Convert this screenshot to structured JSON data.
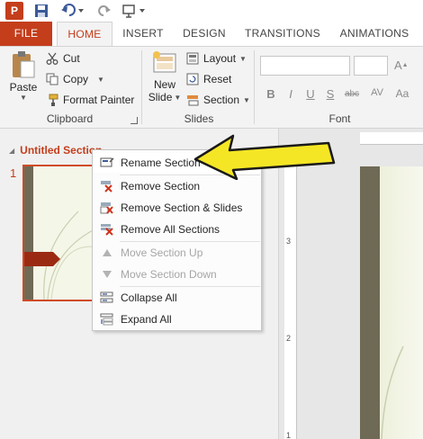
{
  "qat": {
    "app_logo_letter": "P",
    "icons": [
      "powerpoint-logo",
      "save-icon",
      "undo-icon",
      "redo-icon",
      "present-icon"
    ]
  },
  "tabs": [
    {
      "label": "FILE"
    },
    {
      "label": "HOME"
    },
    {
      "label": "INSERT"
    },
    {
      "label": "DESIGN"
    },
    {
      "label": "TRANSITIONS"
    },
    {
      "label": "ANIMATIONS"
    }
  ],
  "ribbon": {
    "clipboard": {
      "paste_label": "Paste",
      "cut_label": "Cut",
      "copy_label": "Copy",
      "format_painter_label": "Format Painter",
      "group_label": "Clipboard"
    },
    "slides": {
      "new_slide_line1": "New",
      "new_slide_line2": "Slide",
      "layout_label": "Layout",
      "reset_label": "Reset",
      "section_label": "Section",
      "group_label": "Slides"
    },
    "font": {
      "format_buttons": [
        "B",
        "I",
        "U",
        "S",
        "abc",
        "AV",
        "Aa"
      ],
      "group_label": "Font"
    }
  },
  "thumbnails": {
    "section_name": "Untitled Section",
    "slide_number": "1"
  },
  "ruler": {
    "v_label_top": "3",
    "v_label_mid": "2",
    "v_label_bottom": "1"
  },
  "context_menu": {
    "items": [
      {
        "label": "Rename Section",
        "icon": "rename-section-icon",
        "enabled": true
      },
      {
        "label": "Remove Section",
        "icon": "remove-section-icon",
        "enabled": true
      },
      {
        "label": "Remove Section & Slides",
        "icon": "remove-section-slides-icon",
        "enabled": true
      },
      {
        "label": "Remove All Sections",
        "icon": "remove-all-sections-icon",
        "enabled": true
      },
      {
        "label": "Move Section Up",
        "icon": "move-up-icon",
        "enabled": false
      },
      {
        "label": "Move Section Down",
        "icon": "move-down-icon",
        "enabled": false
      },
      {
        "label": "Collapse All",
        "icon": "collapse-all-icon",
        "enabled": true
      },
      {
        "label": "Expand All",
        "icon": "expand-all-icon",
        "enabled": true
      }
    ]
  },
  "colors": {
    "accent": "#c43e1c",
    "annotation_arrow": "#f5e625",
    "theme_band": "#6f6a55"
  }
}
